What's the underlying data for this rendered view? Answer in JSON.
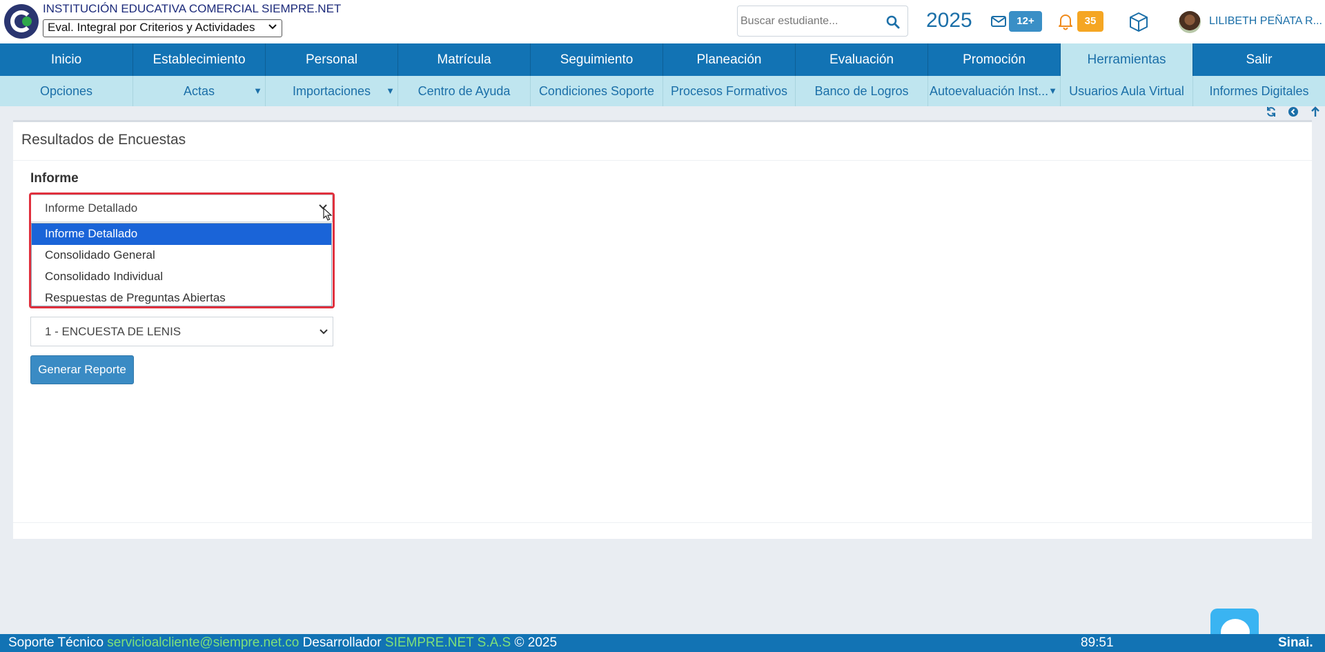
{
  "header": {
    "institution_name": "INSTITUCIÓN EDUCATIVA COMERCIAL SIEMPRE.NET",
    "eval_select_value": "Eval. Integral por Criterios y Actividades",
    "search_placeholder": "Buscar estudiante...",
    "year": "2025",
    "messages_badge": "12+",
    "notifications_badge": "35",
    "user_name": "LILIBETH PEÑATA R..."
  },
  "main_nav": [
    {
      "label": "Inicio",
      "active": false
    },
    {
      "label": "Establecimiento",
      "active": false
    },
    {
      "label": "Personal",
      "active": false
    },
    {
      "label": "Matrícula",
      "active": false
    },
    {
      "label": "Seguimiento",
      "active": false
    },
    {
      "label": "Planeación",
      "active": false
    },
    {
      "label": "Evaluación",
      "active": false
    },
    {
      "label": "Promoción",
      "active": false
    },
    {
      "label": "Herramientas",
      "active": true
    },
    {
      "label": "Salir",
      "active": false
    }
  ],
  "sub_nav": [
    {
      "label": "Opciones",
      "has_dropdown": false
    },
    {
      "label": "Actas",
      "has_dropdown": true
    },
    {
      "label": "Importaciones",
      "has_dropdown": true
    },
    {
      "label": "Centro de Ayuda",
      "has_dropdown": false
    },
    {
      "label": "Condiciones Soporte",
      "has_dropdown": false
    },
    {
      "label": "Procesos Formativos",
      "has_dropdown": false
    },
    {
      "label": "Banco de Logros",
      "has_dropdown": false
    },
    {
      "label": "Autoevaluación Inst...",
      "has_dropdown": true
    },
    {
      "label": "Usuarios Aula Virtual",
      "has_dropdown": false
    },
    {
      "label": "Informes Digitales",
      "has_dropdown": false
    }
  ],
  "panel": {
    "title": "Resultados de Encuestas",
    "informe_label": "Informe",
    "informe_selected": "Informe Detallado",
    "informe_options": [
      "Informe Detallado",
      "Consolidado General",
      "Consolidado Individual",
      "Respuestas de Preguntas Abiertas"
    ],
    "encuesta_selected": "1 - ENCUESTA DE LENIS",
    "generate_button": "Generar Reporte"
  },
  "footer": {
    "support_label": "Soporte Técnico",
    "support_email": "servicioalcliente@siempre.net.co",
    "developer_label": "Desarrollador",
    "developer_name": "SIEMPRE.NET S.A.S",
    "copyright": "© 2025",
    "timer": "89:51",
    "brand": "Sinai."
  },
  "colors": {
    "nav_blue": "#1273b4",
    "nav_light": "#bfe5ef",
    "accent_blue": "#1b6fa8",
    "highlight_red": "#e0303d",
    "selected_option": "#1a64d8",
    "badge_orange": "#f5a623"
  }
}
